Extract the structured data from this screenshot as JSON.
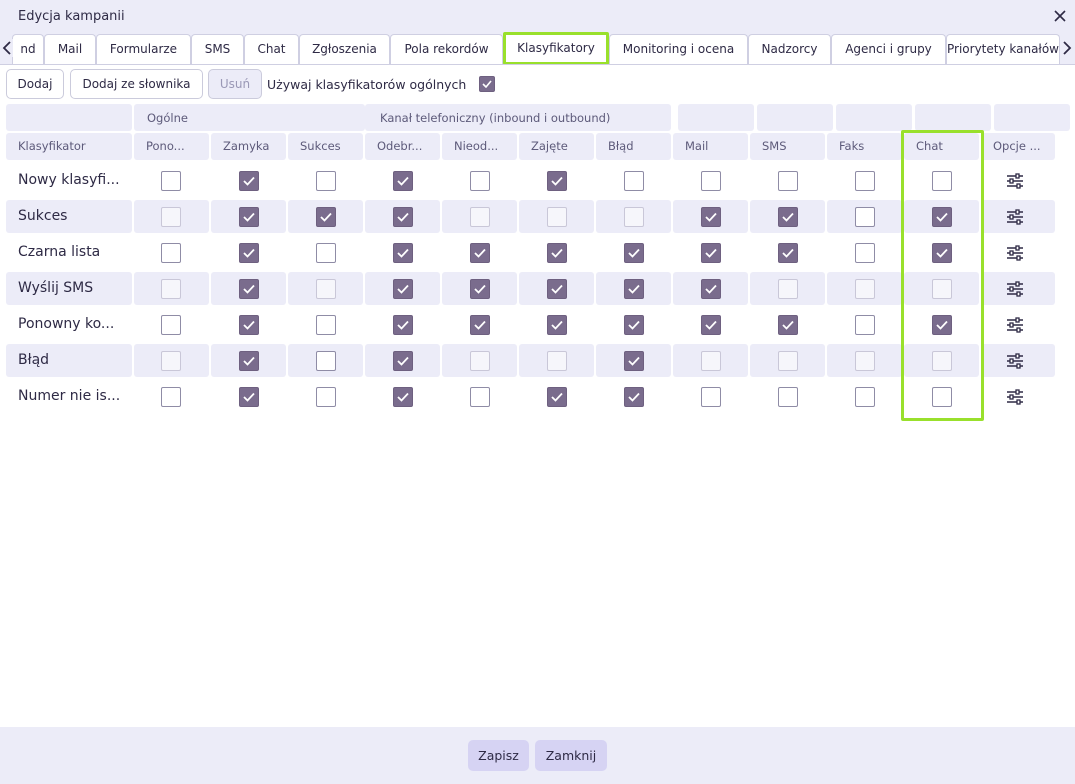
{
  "window": {
    "title": "Edycja kampanii"
  },
  "tabs": [
    {
      "label": "nd"
    },
    {
      "label": "Mail"
    },
    {
      "label": "Formularze"
    },
    {
      "label": "SMS"
    },
    {
      "label": "Chat"
    },
    {
      "label": "Zgłoszenia"
    },
    {
      "label": "Pola rekordów"
    },
    {
      "label": "Klasyfikatory",
      "active": true
    },
    {
      "label": "Monitoring i ocena"
    },
    {
      "label": "Nadzorcy"
    },
    {
      "label": "Agenci i grupy"
    },
    {
      "label": "Priorytety kanałów"
    }
  ],
  "toolbar": {
    "add_label": "Dodaj",
    "add_from_dict_label": "Dodaj ze słownika",
    "delete_label": "Usuń",
    "use_general_label": "Używaj klasyfikatorów ogólnych",
    "use_general_checked": true
  },
  "table": {
    "group_headers": {
      "general": "Ogólne",
      "phone": "Kanał telefoniczny (inbound i outbound)"
    },
    "columns": [
      "Klasyfikator",
      "Pono...",
      "Zamyka",
      "Sukces",
      "Odebr...",
      "Nieod...",
      "Zajęte",
      "Błąd",
      "Mail",
      "SMS",
      "Faks",
      "Chat",
      "Opcje ..."
    ],
    "rows": [
      {
        "name": "Nowy klasyfi...",
        "values": [
          0,
          1,
          0,
          1,
          0,
          1,
          0,
          0,
          0,
          0,
          0
        ]
      },
      {
        "name": "Sukces",
        "values": [
          0,
          1,
          1,
          1,
          0,
          0,
          0,
          1,
          1,
          0,
          1
        ]
      },
      {
        "name": "Czarna lista",
        "values": [
          0,
          1,
          0,
          1,
          1,
          1,
          1,
          1,
          1,
          0,
          1
        ]
      },
      {
        "name": "Wyślij SMS",
        "values": [
          0,
          1,
          0,
          1,
          1,
          1,
          1,
          1,
          0,
          0,
          0
        ]
      },
      {
        "name": "Ponowny ko...",
        "values": [
          0,
          1,
          0,
          1,
          1,
          1,
          1,
          1,
          1,
          0,
          1
        ]
      },
      {
        "name": "Błąd",
        "values": [
          0,
          1,
          0,
          1,
          0,
          0,
          1,
          0,
          0,
          0,
          0
        ]
      },
      {
        "name": "Numer nie is...",
        "values": [
          0,
          1,
          0,
          1,
          0,
          1,
          1,
          0,
          0,
          0,
          0
        ]
      }
    ]
  },
  "footer": {
    "save_label": "Zapisz",
    "close_label": "Zamknij"
  },
  "colors": {
    "accent_highlight": "#99e02c",
    "checkbox_checked": "#7a6c8d",
    "panel_bg": "#ececf8",
    "button_bg": "#d6d3f3"
  },
  "icons": {
    "close": "close-icon",
    "prev": "chevron-left-icon",
    "next": "chevron-right-icon",
    "options": "sliders-icon",
    "check": "check-icon"
  }
}
